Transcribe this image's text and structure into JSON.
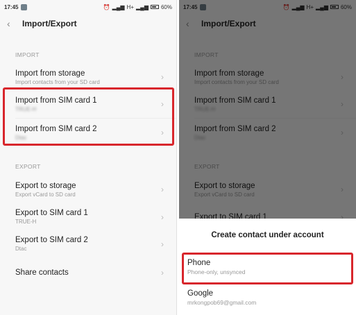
{
  "status": {
    "time": "17:45",
    "signal": "H+",
    "battery": "60%"
  },
  "header": {
    "title": "Import/Export"
  },
  "import": {
    "section_label": "IMPORT",
    "items": [
      {
        "label": "Import from storage",
        "sub": "Import contacts from your SD card"
      },
      {
        "label": "Import from SIM card 1",
        "sub": "TRUE-H"
      },
      {
        "label": "Import from SIM card 2",
        "sub": "Dtac"
      }
    ]
  },
  "export": {
    "section_label": "EXPORT",
    "items": [
      {
        "label": "Export to storage",
        "sub": "Export vCard to SD card"
      },
      {
        "label": "Export to SIM card 1",
        "sub": "TRUE-H"
      },
      {
        "label": "Export to SIM card 2",
        "sub": "Dtac"
      },
      {
        "label": "Share contacts",
        "sub": ""
      }
    ]
  },
  "sheet": {
    "title": "Create contact under account",
    "options": [
      {
        "label": "Phone",
        "sub": "Phone-only, unsynced"
      },
      {
        "label": "Google",
        "sub": "mrkongpob69@gmail.com"
      }
    ]
  },
  "colors": {
    "highlight": "#d8262c",
    "overlay": "rgba(0,0,0,0.52)"
  },
  "icons": {
    "back": "chevron-left-icon",
    "row": "chevron-right-icon"
  }
}
